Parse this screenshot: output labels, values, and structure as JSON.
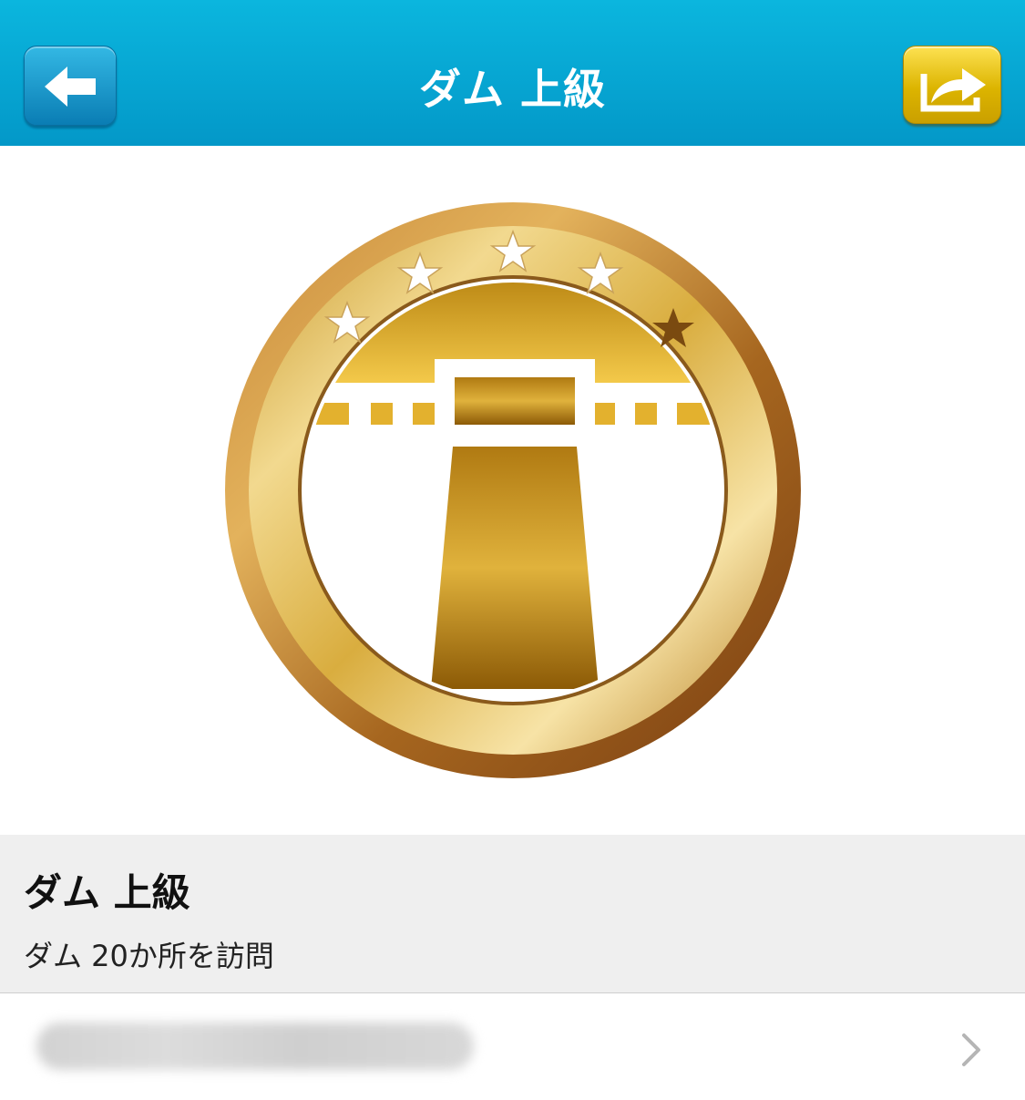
{
  "navbar": {
    "title": "ダム 上級",
    "back_icon": "back-arrow-icon",
    "share_icon": "share-icon",
    "colors": {
      "bar": "#08a8d6",
      "back_button": "#1a9fd2",
      "share_button": "#e8c11a"
    }
  },
  "badge": {
    "icon": "dam-medal",
    "stars_total": 5,
    "stars_earned": 4,
    "colors": {
      "gold": "#d4a52a",
      "dark_gold": "#8a5a1c",
      "star": "#ffffff",
      "unearned_star": "#7a4a10"
    }
  },
  "detail": {
    "title": "ダム 上級",
    "description": "ダム 20か所を訪問"
  },
  "list_row": {
    "chevron_icon": "chevron-right-icon"
  }
}
